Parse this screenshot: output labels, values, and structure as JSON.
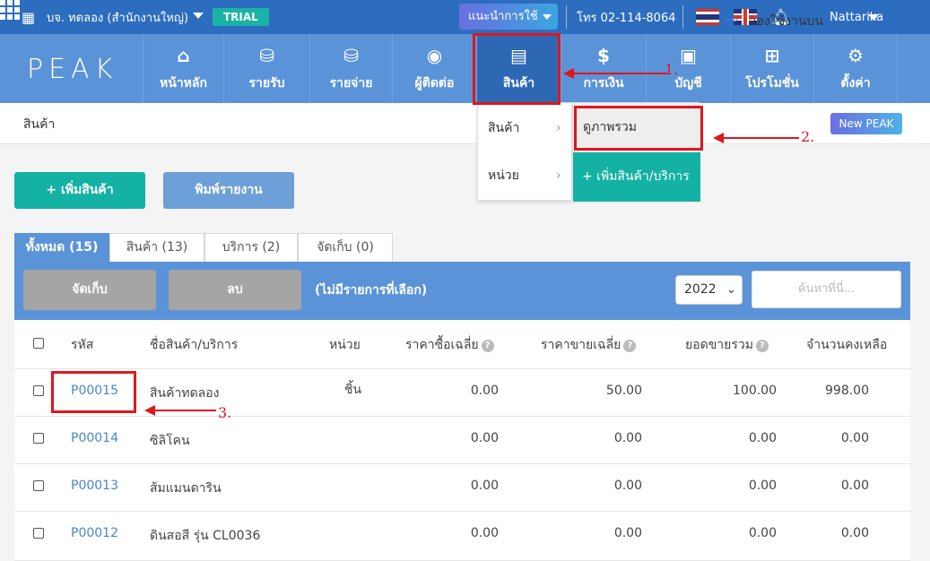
{
  "topbar": {
    "company": "บจ. ทดลอง (สำนักงานใหญ่)",
    "trial": "TRIAL",
    "guide_btn": "แนะนำการใช้",
    "phone": "โทร 02-114-8064",
    "user": "Nattarika"
  },
  "nav": {
    "logo": "PEAK",
    "items": [
      {
        "label": "หน้าหลัก",
        "icon": "home-icon"
      },
      {
        "label": "รายรับ",
        "icon": "income-icon"
      },
      {
        "label": "รายจ่าย",
        "icon": "expense-icon"
      },
      {
        "label": "ผู้ติดต่อ",
        "icon": "contact-icon"
      },
      {
        "label": "สินค้า",
        "icon": "product-icon"
      },
      {
        "label": "การเงิน",
        "icon": "money-bag-icon"
      },
      {
        "label": "บัญชี",
        "icon": "briefcase-icon"
      },
      {
        "label": "โปรโมชั่น",
        "icon": "gift-icon"
      },
      {
        "label": "ตั้งค่า",
        "icon": "gear-icon"
      }
    ]
  },
  "breadcrumb": "สินค้า",
  "try_new": "ลองใช้งานบน",
  "new_peak": "New PEAK",
  "dropdown": {
    "items": [
      "สินค้า",
      "หน่วย"
    ],
    "submenu": {
      "overview": "ดูภาพรวม",
      "add": "+ เพิ่มสินค้า/บริการ"
    }
  },
  "buttons": {
    "add": "+ เพิ่มสินค้า",
    "print": "พิมพ์รายงาน"
  },
  "tabs": [
    "ทั้งหมด (15)",
    "สินค้า (13)",
    "บริการ (2)",
    "จัดเก็บ (0)"
  ],
  "panel": {
    "archive": "จัดเก็บ",
    "delete": "ลบ",
    "no_selection": "(ไม่มีรายการที่เลือก)",
    "year": "2022",
    "search_placeholder": "ค้นหาที่นี่..."
  },
  "table": {
    "headers": [
      "รหัส",
      "ชื่อสินค้า/บริการ",
      "หน่วย",
      "ราคาซื้อเฉลี่ย",
      "ราคาขายเฉลี่ย",
      "ยอดขายรวม",
      "จำนวนคงเหลือ"
    ],
    "rows": [
      {
        "code": "P00015",
        "name": "สินค้าทดลอง",
        "unit": "ชิ้น",
        "buy": "0.00",
        "sell": "50.00",
        "total": "100.00",
        "qty": "998.00"
      },
      {
        "code": "P00014",
        "name": "ซิลิโคน",
        "unit": "",
        "buy": "0.00",
        "sell": "0.00",
        "total": "0.00",
        "qty": "0.00"
      },
      {
        "code": "P00013",
        "name": "ส้มแมนดาริน",
        "unit": "",
        "buy": "0.00",
        "sell": "0.00",
        "total": "0.00",
        "qty": "0.00"
      },
      {
        "code": "P00012",
        "name": "ดินสอสี รุ่น CL0036",
        "unit": "",
        "buy": "0.00",
        "sell": "0.00",
        "total": "0.00",
        "qty": "0.00"
      }
    ]
  },
  "annotations": [
    "1.",
    "2.",
    "3."
  ],
  "colors": {
    "topbar": "#2d6dbf",
    "nav": "#5b93d9",
    "teal": "#14b1a5",
    "annotation": "#e0161c"
  }
}
